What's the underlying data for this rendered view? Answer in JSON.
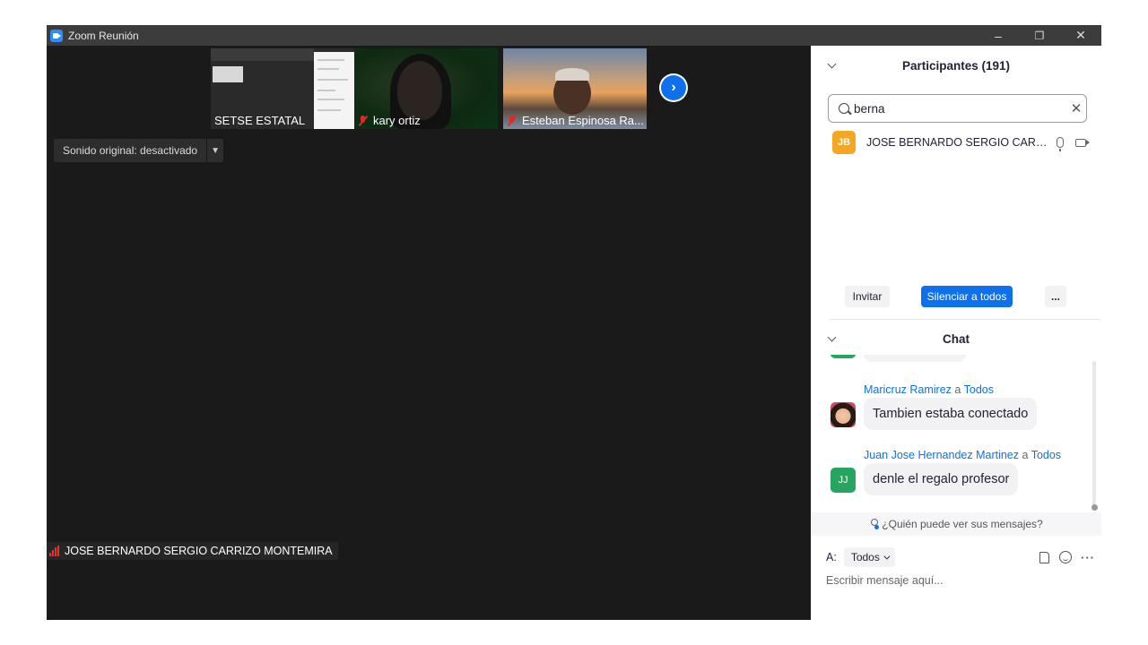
{
  "window": {
    "title": "Zoom Reunión",
    "controls": {
      "minimize": "–",
      "restore": "❐",
      "close": "✕"
    }
  },
  "video": {
    "thumbnails": [
      {
        "name": "SETSE ESTATAL",
        "muted": false
      },
      {
        "name": "kary ortiz",
        "muted": true
      },
      {
        "name": "Esteban Espinosa Ra...",
        "muted": true
      }
    ],
    "next_icon": "chevron-right-icon",
    "audio_toggle": {
      "label": "Sonido original: desactivado"
    },
    "active_speaker": "JOSE BERNARDO SERGIO CARRIZO MONTEMIRA"
  },
  "participants": {
    "header": "Participantes (191)",
    "search": {
      "value": "berna"
    },
    "list": [
      {
        "initials": "JB",
        "name": "JOSE BERNARDO SERGIO CARRIZ...",
        "avatar_color": "#f5a623"
      }
    ],
    "buttons": {
      "invite": "Invitar",
      "mute_all": "Silenciar a todos",
      "more": "..."
    }
  },
  "chat": {
    "header": "Chat",
    "messages": [
      {
        "sender": "Maricruz Ramirez",
        "to_word": "a",
        "recipient": "Todos",
        "text": "Tambien estaba conectado"
      },
      {
        "sender": "Juan Jose Hernandez Martinez",
        "to_word": "a",
        "recipient": "Todos",
        "text": "denle el regalo profesor",
        "initials": "JJ",
        "avatar_color": "#25a55f"
      }
    ],
    "privacy_text": "¿Quién puede ver sus mensajes?",
    "composer": {
      "to_label": "A:",
      "recipient": "Todos",
      "placeholder": "Escribir mensaje aquí..."
    }
  },
  "colors": {
    "accent": "#0e71eb",
    "muted_red": "#e02828"
  }
}
